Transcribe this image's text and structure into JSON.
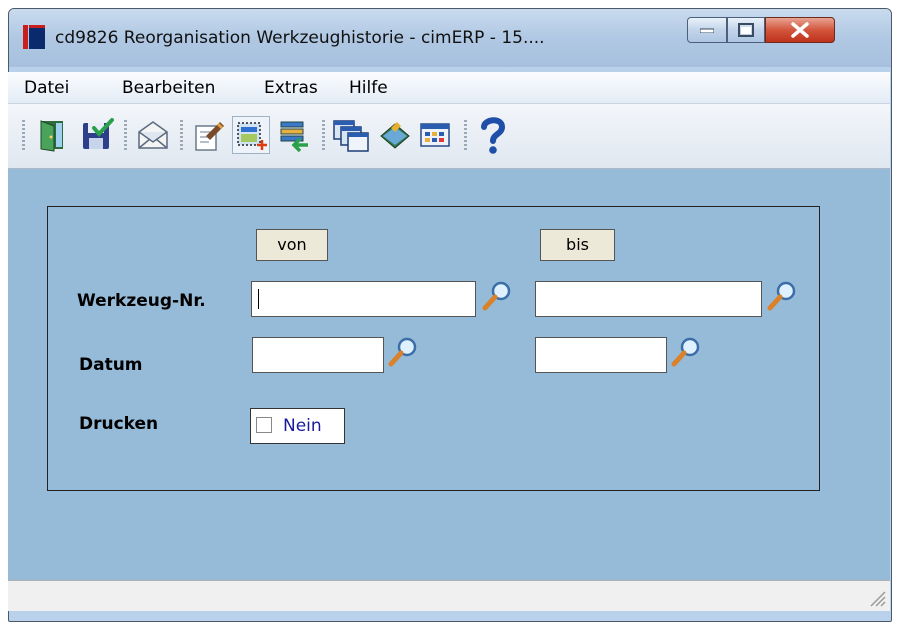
{
  "window": {
    "title": "cd9826 Reorganisation Werkzeughistorie - cimERP - 15...."
  },
  "menu": {
    "items": [
      "Datei",
      "Bearbeiten",
      "Extras",
      "Hilfe"
    ]
  },
  "toolbar": {
    "icons": [
      "exit-door-icon",
      "save-check-icon",
      "mail-icon",
      "edit-notes-icon",
      "new-record-icon",
      "transfer-icon",
      "windows-icon",
      "book-icon",
      "calendar-grid-icon",
      "help-icon"
    ]
  },
  "form": {
    "col_from": "von",
    "col_to": "bis",
    "tool_no_label": "Werkzeug-Nr.",
    "tool_no_from": "",
    "tool_no_to": "",
    "date_label": "Datum",
    "date_from": "",
    "date_to": "",
    "print_label": "Drucken",
    "print_checked": false,
    "print_value_text": "Nein"
  },
  "colors": {
    "content_bg": "#96bbd8",
    "titlebar_bg": "#b9d1ea",
    "close_red": "#c0321b"
  }
}
